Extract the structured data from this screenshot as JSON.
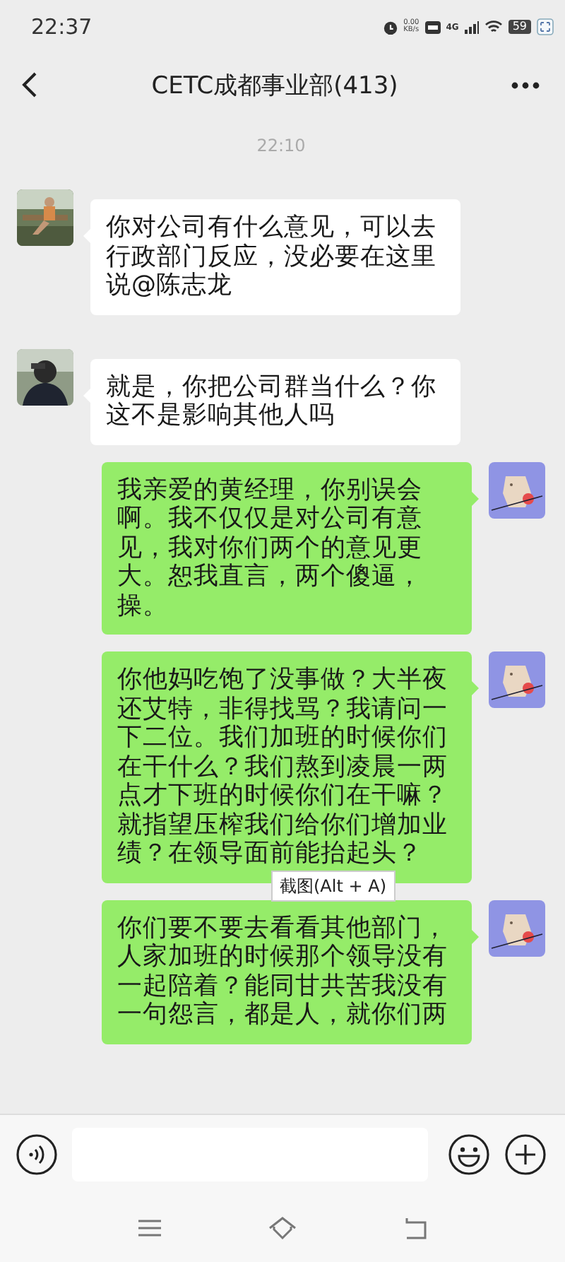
{
  "status_bar": {
    "time": "22:37",
    "net_speed": "0.00",
    "net_unit": "KB/s",
    "network": "4G",
    "battery": "59"
  },
  "header": {
    "title": "CETC成都事业部(413)"
  },
  "timestamp": "22:10",
  "messages": [
    {
      "kind": "incoming",
      "text": "你对公司有什么意见，可以去行政部门反应，没必要在这里说@陈志龙"
    },
    {
      "kind": "incoming",
      "text": "就是，你把公司群当什么？你这不是影响其他人吗"
    },
    {
      "kind": "outgoing",
      "text": "我亲爱的黄经理，你别误会啊。我不仅仅是对公司有意见，我对你们两个的意见更大。恕我直言，两个傻逼，操。"
    },
    {
      "kind": "outgoing",
      "text": "你他妈吃饱了没事做？大半夜还艾特，非得找骂？我请问一下二位。我们加班的时候你们在干什么？我们熬到凌晨一两点才下班的时候你们在干嘛？就指望压榨我们给你们增加业绩？在领导面前能抬起头？"
    },
    {
      "kind": "outgoing",
      "text": "你们要不要去看看其他部门，人家加班的时候那个领导没有一起陪着？能同甘共苦我没有一句怨言，都是人，就你们两"
    }
  ],
  "tooltip": "截图(Alt + A)"
}
